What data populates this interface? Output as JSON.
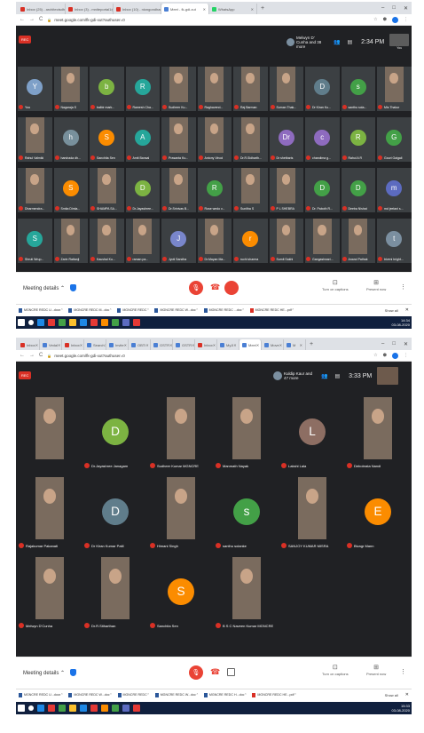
{
  "shotA": {
    "tabs": [
      {
        "label": "Inbox (25) - architectsdhanb..."
      },
      {
        "label": "Inbox (3) - mniteportal1@gm..."
      },
      {
        "label": "Inbox (10) - niongondhanb..."
      },
      {
        "label": "Meet - fk-gdi-xut"
      },
      {
        "label": "WhatsApp"
      }
    ],
    "url": "meet.google.com/fk-gdi-xut?authuser=0",
    "rec": "REC",
    "others": "Melwyn D' Cunha and 38 more",
    "time": "2:34 PM",
    "you": "You",
    "participants": [
      {
        "name": "You",
        "initial": "Y",
        "color": "#7ea0c8"
      },
      {
        "name": "Nagaraja S",
        "initial": "",
        "color": ""
      },
      {
        "name": "balbir mark...",
        "initial": "b",
        "color": "#7cb342"
      },
      {
        "name": "Ramesh Cha...",
        "initial": "R",
        "color": "#26a69a"
      },
      {
        "name": "Sudheer Ku...",
        "initial": "",
        "color": ""
      },
      {
        "name": "Raghavend...",
        "initial": "",
        "color": ""
      },
      {
        "name": "Raj Barman",
        "initial": "",
        "color": ""
      },
      {
        "name": "Suman Thak...",
        "initial": "",
        "color": ""
      },
      {
        "name": "Dr Kiran Ku...",
        "initial": "D",
        "color": "#607d8b"
      },
      {
        "name": "santhu sola...",
        "initial": "s",
        "color": "#43a047"
      },
      {
        "name": "Mis Thakur",
        "initial": "",
        "color": ""
      },
      {
        "name": "Rahul Valmiki",
        "initial": "",
        "color": ""
      },
      {
        "name": "harshada dh...",
        "initial": "h",
        "color": "#78909c"
      },
      {
        "name": "Sanchita Sen",
        "initial": "S",
        "color": "#fb8c00"
      },
      {
        "name": "Amit Bansal",
        "initial": "A",
        "color": "#26a69a"
      },
      {
        "name": "Prasanta Ku...",
        "initial": "",
        "color": ""
      },
      {
        "name": "Antony Vinod",
        "initial": "",
        "color": ""
      },
      {
        "name": "Dr.R.Sidharth...",
        "initial": "",
        "color": ""
      },
      {
        "name": "Dr shetbaris",
        "initial": "Dr",
        "color": "#8e6bbf"
      },
      {
        "name": "chandima g...",
        "initial": "c",
        "color": "#8e6bbf"
      },
      {
        "name": "Rahul A R",
        "initial": "R",
        "color": "#7cb342"
      },
      {
        "name": "Gouri Gaigali",
        "initial": "G",
        "color": "#43a047"
      },
      {
        "name": "Dharmendra...",
        "initial": "",
        "color": ""
      },
      {
        "name": "Smita Dimla...",
        "initial": "S",
        "color": "#fb8c00"
      },
      {
        "name": "SHAMPA SA...",
        "initial": "",
        "color": ""
      },
      {
        "name": "Dr.Jayashree...",
        "initial": "D",
        "color": "#7cb342"
      },
      {
        "name": "Dr.Srinivas B...",
        "initial": "",
        "color": ""
      },
      {
        "name": "Rose wedo v...",
        "initial": "R",
        "color": "#43a047"
      },
      {
        "name": "Sunitha S",
        "initial": "",
        "color": ""
      },
      {
        "name": "P L SHEBRA",
        "initial": "",
        "color": ""
      },
      {
        "name": "Dr. Paboth R...",
        "initial": "D",
        "color": "#43a047"
      },
      {
        "name": "Deeba Nishat",
        "initial": "D",
        "color": "#43a047"
      },
      {
        "name": "md jeelani s...",
        "initial": "m",
        "color": "#5c6bc0"
      },
      {
        "name": "Shruti Wrup...",
        "initial": "S",
        "color": "#26a69a"
      },
      {
        "name": "Zarin Rattanji",
        "initial": "",
        "color": ""
      },
      {
        "name": "Kaushal Ku...",
        "initial": "",
        "color": ""
      },
      {
        "name": "raman pa...",
        "initial": "",
        "color": ""
      },
      {
        "name": "Jyoti Sandha",
        "initial": "J",
        "color": "#7986cb"
      },
      {
        "name": "Dr.Mayan Ma...",
        "initial": "",
        "color": ""
      },
      {
        "name": "ruchi sharma",
        "initial": "r",
        "color": "#fb8c00"
      },
      {
        "name": "Sumit Sakhi",
        "initial": "",
        "color": ""
      },
      {
        "name": "Gangashwari...",
        "initial": "",
        "color": ""
      },
      {
        "name": "Anand Pathak",
        "initial": "",
        "color": ""
      },
      {
        "name": "triveni bright...",
        "initial": "t",
        "color": "#7b8fa0"
      }
    ],
    "meeting_details": "Meeting details",
    "captions": "Turn on captions",
    "present": "Present now",
    "downloads": [
      {
        "name": "MGNCRE REDC U...docx",
        "kind": "doc"
      },
      {
        "name": "MGNCRE REDC M...doc",
        "kind": "doc"
      },
      {
        "name": "MGNCRE REDC",
        "kind": "doc"
      },
      {
        "name": "MGNCRE REDC W...doc",
        "kind": "doc"
      },
      {
        "name": "MGNCRE REDC ...doc",
        "kind": "doc"
      },
      {
        "name": "MGNCRE REDC HE...pdf",
        "kind": "pdf"
      }
    ],
    "show_all": "Show all",
    "tray_time": "14:34",
    "tray_date": "03-08-2020"
  },
  "shotB": {
    "tabs": [
      {
        "label": "Inbox"
      },
      {
        "label": "Vedal"
      },
      {
        "label": "Inbox"
      },
      {
        "label": "Search"
      },
      {
        "label": "Invite"
      },
      {
        "label": "OBTI"
      },
      {
        "label": "GSTR"
      },
      {
        "label": "GSTR"
      },
      {
        "label": "Inbox"
      },
      {
        "label": "MyJi"
      },
      {
        "label": "Meet"
      },
      {
        "label": "Move"
      },
      {
        "label": "M"
      }
    ],
    "url": "meet.google.com/fk-gdi-xut?authuser=0",
    "rec": "REC",
    "others": "Kuldip Kaur and 47 more",
    "time": "3:33 PM",
    "participants": [
      {
        "name": "",
        "initial": "",
        "color": ""
      },
      {
        "name": "Dr.Jayashree Janagam",
        "initial": "D",
        "color": "#7cb342"
      },
      {
        "name": "Sudheer Kumar MGNCRE",
        "initial": "",
        "color": ""
      },
      {
        "name": "Manmath Nayak",
        "initial": "",
        "color": ""
      },
      {
        "name": "Lakshi Lala",
        "initial": "L",
        "color": "#8d6e63"
      },
      {
        "name": "Debobrata Nandi",
        "initial": "",
        "color": ""
      },
      {
        "name": "Rajakumar Pakanati",
        "initial": "",
        "color": ""
      },
      {
        "name": "Dr Kiran Kumar Patil",
        "initial": "D",
        "color": "#607d8b"
      },
      {
        "name": "Himani Singh",
        "initial": "",
        "color": ""
      },
      {
        "name": "santhu solanke",
        "initial": "s",
        "color": "#43a047"
      },
      {
        "name": "SANJOY KUMAR MISRA",
        "initial": "",
        "color": ""
      },
      {
        "name": "Bivagr Mann",
        "initial": "E",
        "color": "#fb8c00"
      },
      {
        "name": "Melwyn D'Cunha",
        "initial": "",
        "color": ""
      },
      {
        "name": "Dr.R.Sitharthan",
        "initial": "",
        "color": ""
      },
      {
        "name": "Sanchita Sen",
        "initial": "S",
        "color": "#fb8c00"
      },
      {
        "name": "B S C Naveen Kumar MGNCRE",
        "initial": "",
        "color": ""
      }
    ],
    "meeting_details": "Meeting details",
    "captions": "Turn on captions",
    "present": "Present now",
    "downloads": [
      {
        "name": "MGNCRE REDC U...docx",
        "kind": "doc"
      },
      {
        "name": "MGNCRE REDC W...doc",
        "kind": "doc"
      },
      {
        "name": "MGNCRE REDC",
        "kind": "doc"
      },
      {
        "name": "MGNCRE REDC W...doc",
        "kind": "doc"
      },
      {
        "name": "MGNCRE REDC H...doc",
        "kind": "doc"
      },
      {
        "name": "MGNCRE REDC HE...pdf",
        "kind": "pdf"
      }
    ],
    "show_all": "Show all",
    "tray_time": "15:33",
    "tray_date": "03-08-2020"
  },
  "colors": {
    "meet_bg": "#202124",
    "tile_bg": "#3c4043",
    "accent_red": "#ea4335",
    "rec_red": "#d93025"
  }
}
